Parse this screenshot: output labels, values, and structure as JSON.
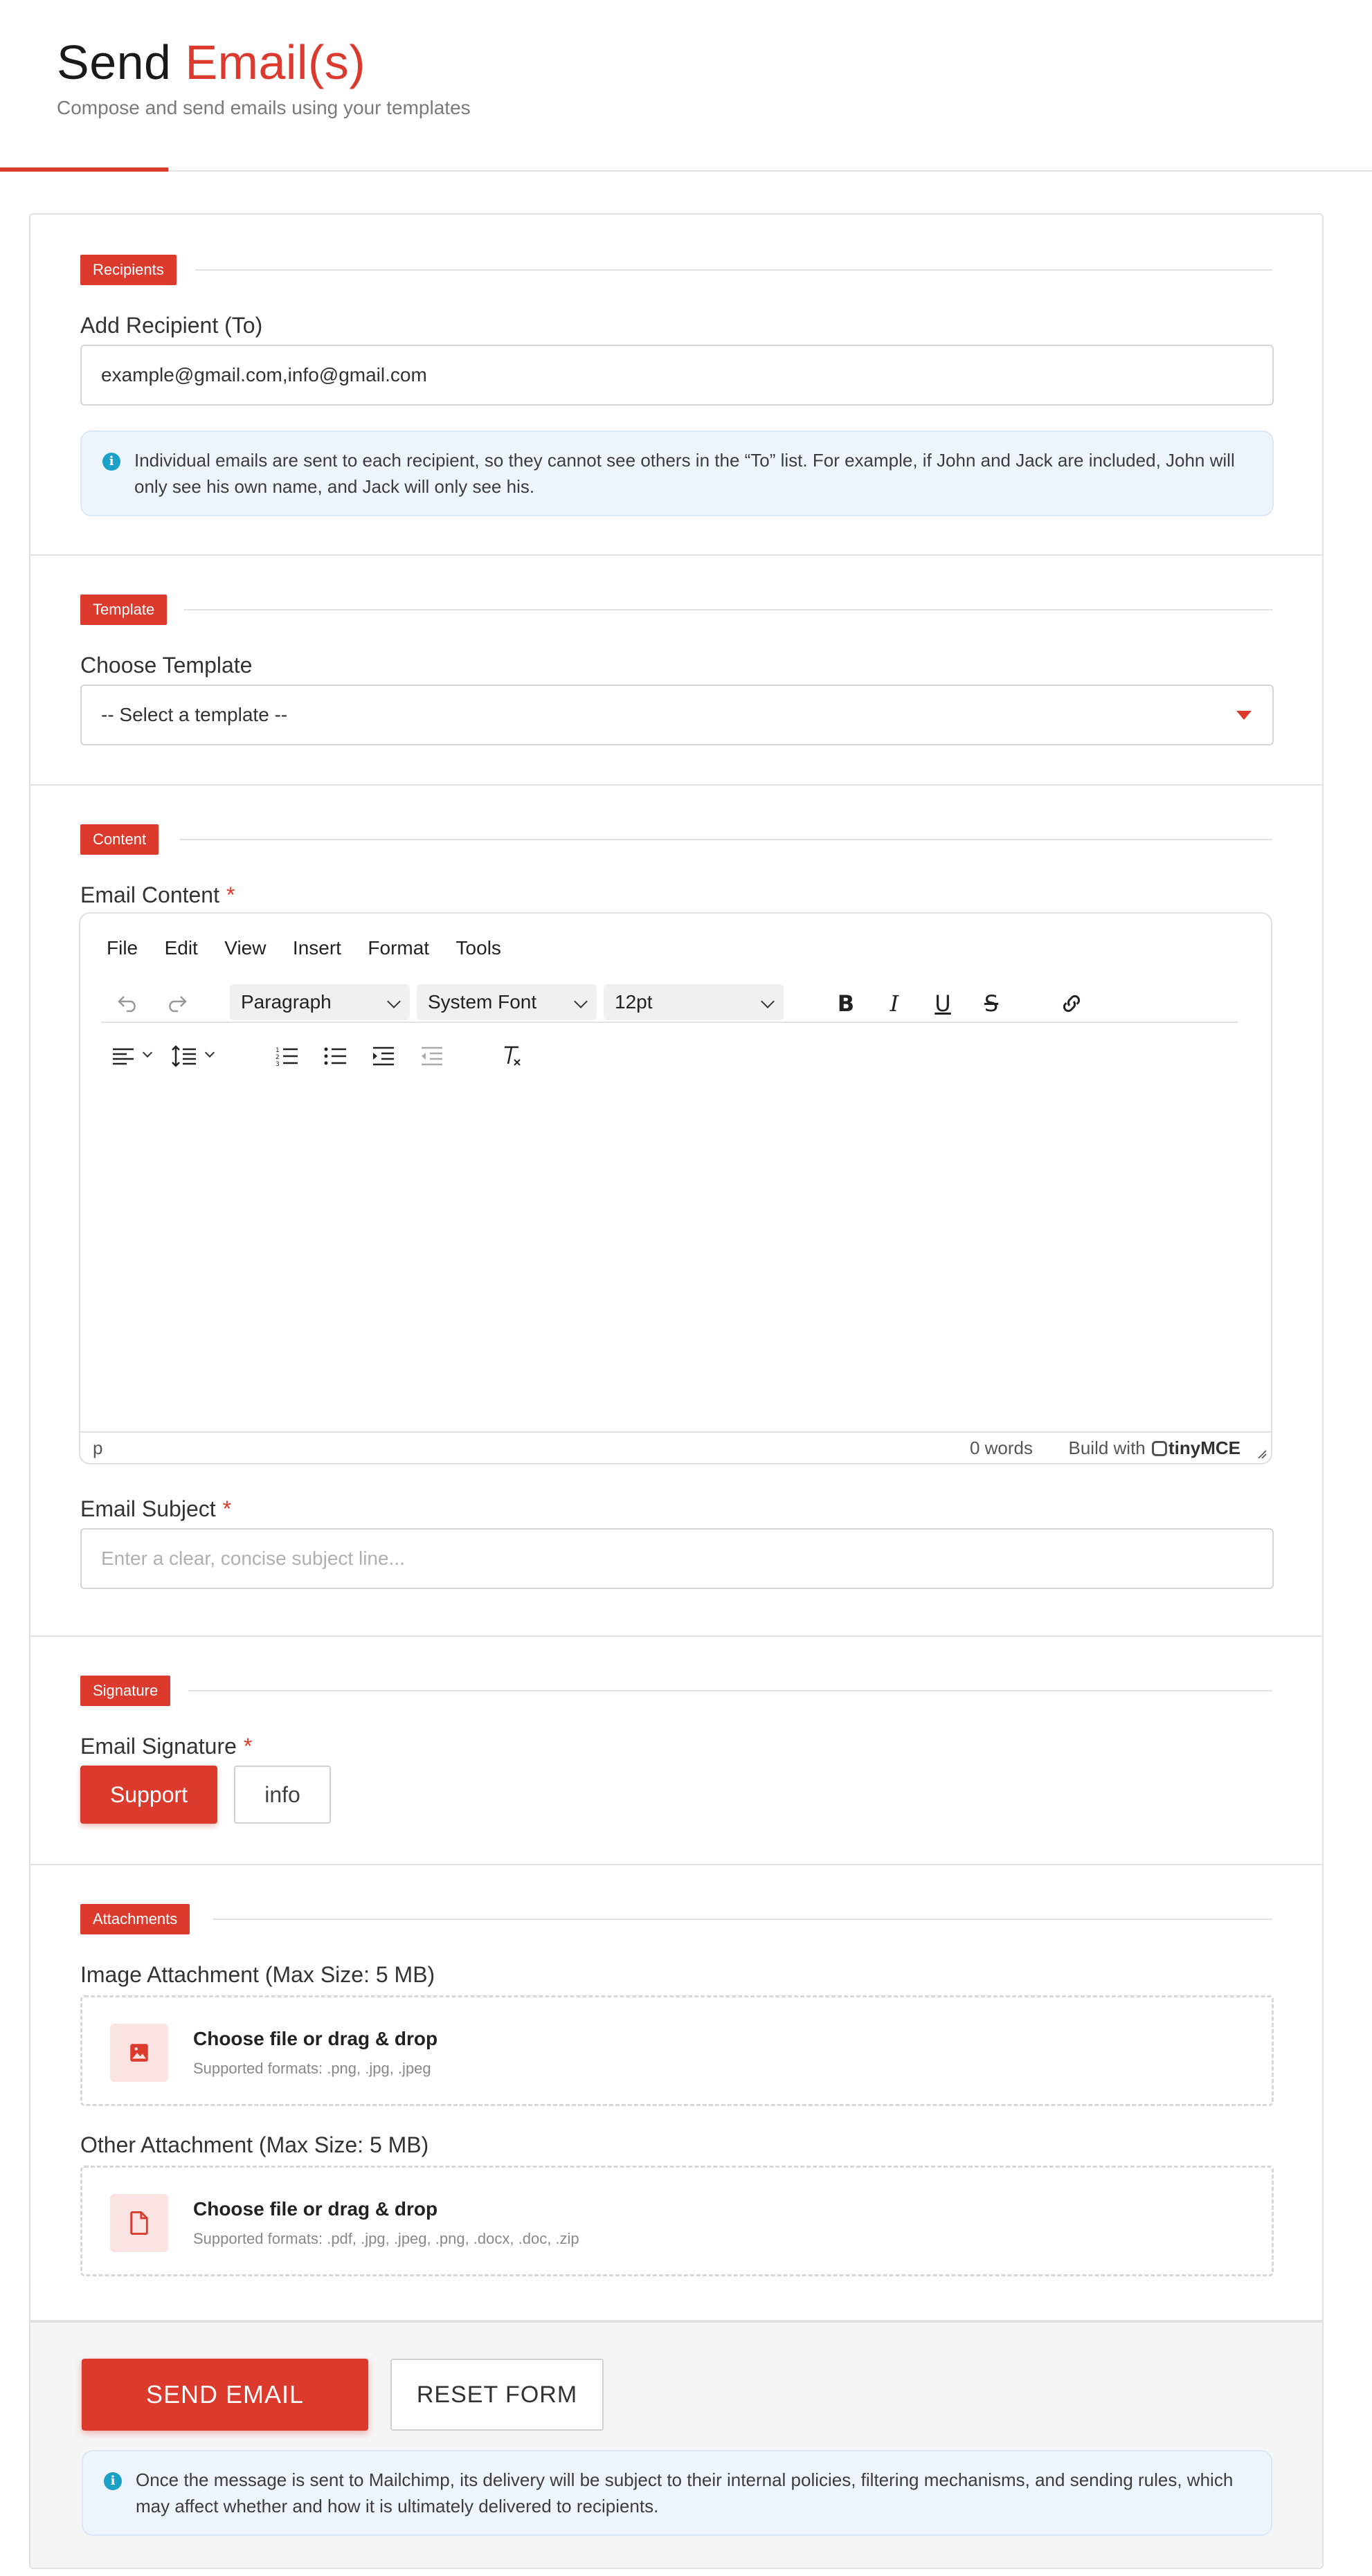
{
  "header": {
    "title_part1": "Send",
    "title_part2": "Email(s)",
    "subtitle": "Compose and send emails using your templates"
  },
  "recipients": {
    "tag": "Recipients",
    "label": "Add Recipient (To)",
    "value": "example@gmail.com,info@gmail.com",
    "info": "Individual emails are sent to each recipient, so they cannot see others in the “To” list. For example, if John and Jack are included, John will only see his own name, and Jack will only see his."
  },
  "template": {
    "tag": "Template",
    "label": "Choose Template",
    "selected": "-- Select a template --"
  },
  "content": {
    "tag": "Content",
    "label": "Email Content",
    "required_mark": "*",
    "editor": {
      "menu": [
        "File",
        "Edit",
        "View",
        "Insert",
        "Format",
        "Tools"
      ],
      "block_format": "Paragraph",
      "font_family": "System Font",
      "font_size": "12pt",
      "status_path": "p",
      "word_count": "0 words",
      "brand_prefix": "Build with",
      "brand_name": "tinyMCE"
    },
    "subject_label": "Email Subject",
    "subject_placeholder": "Enter a clear, concise subject line..."
  },
  "signature": {
    "tag": "Signature",
    "label": "Email Signature",
    "required_mark": "*",
    "options": [
      "Support",
      "info"
    ],
    "selected": "Support"
  },
  "attachments": {
    "tag": "Attachments",
    "image_label": "Image Attachment (Max Size: 5 MB)",
    "image_title": "Choose file or drag & drop",
    "image_formats": "Supported formats: .png, .jpg, .jpeg",
    "other_label": "Other Attachment (Max Size: 5 MB)",
    "other_title": "Choose file or drag & drop",
    "other_formats": "Supported formats: .pdf, .jpg, .jpeg, .png, .docx, .doc, .zip"
  },
  "actions": {
    "send_label": "SEND EMAIL",
    "reset_label": "RESET FORM",
    "info": "Once the message is sent to Mailchimp, its delivery will be subject to their internal policies, filtering mechanisms, and sending rules, which may affect whether and how it is ultimately delivered to recipients."
  },
  "colors": {
    "accent": "#dc3a2d",
    "info_bg": "#edf4fc",
    "info_icon": "#1ba0c8"
  }
}
